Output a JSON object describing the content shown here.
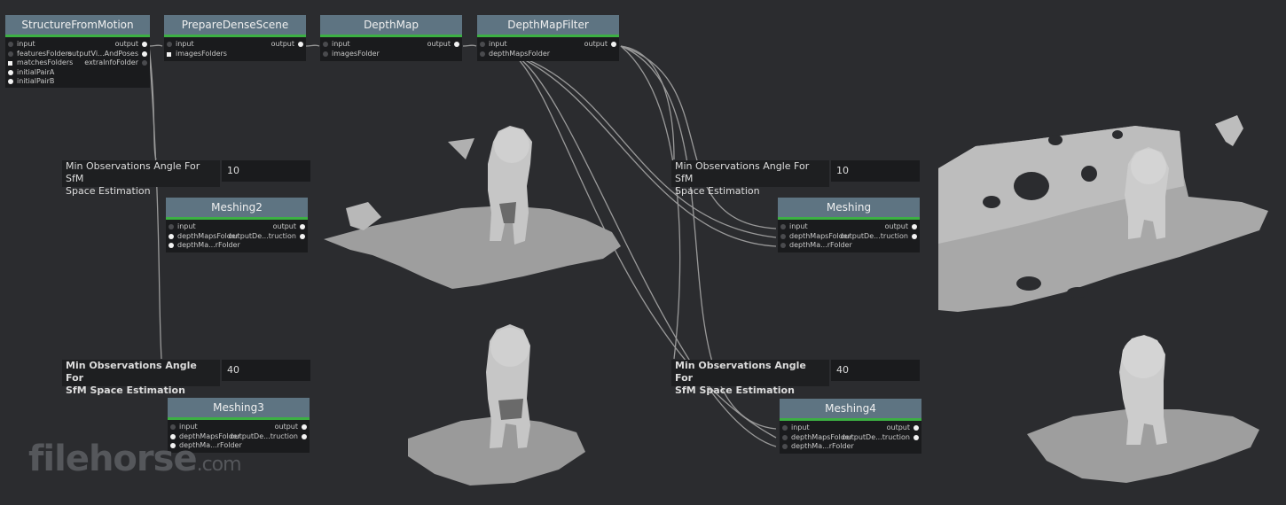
{
  "nodes": {
    "sfm": {
      "title": "StructureFromMotion",
      "inputs": [
        "input",
        "featuresFolders",
        "matchesFolders",
        "initialPairA",
        "initialPairB"
      ],
      "outputs": [
        "output",
        "outputVi...AndPoses",
        "extraInfoFolder"
      ]
    },
    "pds": {
      "title": "PrepareDenseScene",
      "inputs": [
        "input",
        "imagesFolders"
      ],
      "outputs": [
        "output"
      ]
    },
    "dm": {
      "title": "DepthMap",
      "inputs": [
        "input",
        "imagesFolder"
      ],
      "outputs": [
        "output"
      ]
    },
    "dmf": {
      "title": "DepthMapFilter",
      "inputs": [
        "input",
        "depthMapsFolder"
      ],
      "outputs": [
        "output"
      ]
    },
    "meshing2": {
      "title": "Meshing2",
      "inputs": [
        "input",
        "depthMapsFolder",
        "depthMa...rFolder"
      ],
      "outputs": [
        "output",
        "outputDe...truction"
      ]
    },
    "meshing3": {
      "title": "Meshing3",
      "inputs": [
        "input",
        "depthMapsFolder",
        "depthMa...rFolder"
      ],
      "outputs": [
        "output",
        "outputDe...truction"
      ]
    },
    "meshing": {
      "title": "Meshing",
      "inputs": [
        "input",
        "depthMapsFolder",
        "depthMa...rFolder"
      ],
      "outputs": [
        "output",
        "outputDe...truction"
      ]
    },
    "meshing4": {
      "title": "Meshing4",
      "inputs": [
        "input",
        "depthMapsFolder",
        "depthMa...rFolder"
      ],
      "outputs": [
        "output",
        "outputDe...truction"
      ]
    }
  },
  "attrs": {
    "a1": {
      "label1": "Min Observations Angle For SfM",
      "label2": "Space Estimation",
      "value": "10"
    },
    "a2": {
      "label1": "Min Observations Angle For",
      "label2": "SfM Space Estimation",
      "value": "40"
    },
    "a3": {
      "label1": "Min Observations Angle For SfM",
      "label2": "Space Estimation",
      "value": "10"
    },
    "a4": {
      "label1": "Min Observations Angle For",
      "label2": "SfM Space Estimation",
      "value": "40"
    }
  },
  "watermark": {
    "main": "filehorse",
    "suffix": ".com"
  },
  "colors": {
    "background": "#2b2c2f",
    "node_header": "#5e7482",
    "node_accent": "#3cb043",
    "mesh": "#bfbfbf"
  }
}
